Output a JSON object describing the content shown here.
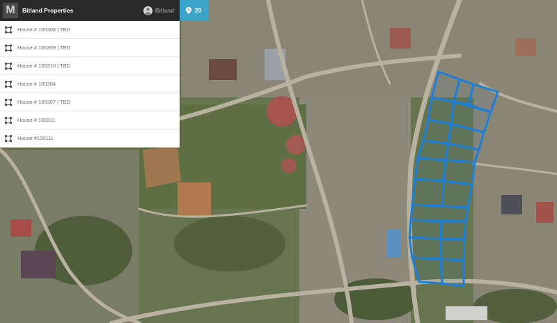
{
  "app": {
    "logo_letter": "M",
    "title": "Bitland Properties",
    "user_name": "Bitland",
    "parcel_count": "20",
    "brand_color": "#3ba4c9"
  },
  "parcels": [
    {
      "label": "House # 100308 | TBD"
    },
    {
      "label": "House # 100309 | TBD"
    },
    {
      "label": "House # 100310 | TBD"
    },
    {
      "label": "House # 100304"
    },
    {
      "label": "House # 100307 | TBD"
    },
    {
      "label": "House # 100311"
    },
    {
      "label": "House #100111"
    }
  ],
  "map": {
    "type": "satellite",
    "parcel_outline_color": "#1e7fd6",
    "parcel_count_drawn": 20
  }
}
